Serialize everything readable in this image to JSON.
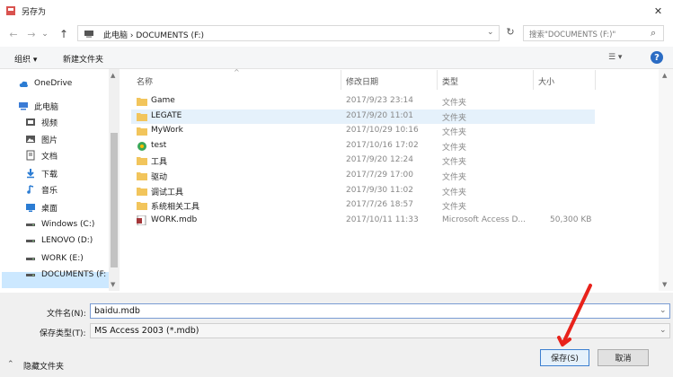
{
  "window": {
    "title": "另存为",
    "close_glyph": "✕"
  },
  "nav": {
    "back_glyph": "←",
    "forward_glyph": "→",
    "dropdown_glyph": "⌄",
    "up_glyph": "↑",
    "address": "此电脑  ›  DOCUMENTS (F:)",
    "search_placeholder": "搜索\"DOCUMENTS (F:)\"",
    "refresh_glyph": "↻",
    "search_glyph": "⌕"
  },
  "toolbar": {
    "organize": "组织 ▾",
    "new_folder": "新建文件夹",
    "view_glyph": "☰ ▾",
    "help_glyph": "?"
  },
  "sidebar": {
    "items": [
      {
        "label": "OneDrive",
        "icon": "cloud-icon",
        "color": "#2b7cd3"
      },
      {
        "label": "此电脑",
        "icon": "computer-icon",
        "color": "#3a7bd5"
      },
      {
        "label": "视频",
        "icon": "video-icon",
        "color": "#555555"
      },
      {
        "label": "图片",
        "icon": "picture-icon",
        "color": "#555555"
      },
      {
        "label": "文档",
        "icon": "document-icon",
        "color": "#555555"
      },
      {
        "label": "下载",
        "icon": "download-icon",
        "color": "#2b7cd3"
      },
      {
        "label": "音乐",
        "icon": "music-icon",
        "color": "#2b7cd3"
      },
      {
        "label": "桌面",
        "icon": "desktop-icon",
        "color": "#2b7cd3"
      },
      {
        "label": "Windows (C:)",
        "icon": "drive-icon",
        "color": "#555555"
      },
      {
        "label": "LENOVO (D:)",
        "icon": "drive-icon",
        "color": "#555555"
      },
      {
        "label": "WORK (E:)",
        "icon": "drive-icon",
        "color": "#555555"
      },
      {
        "label": "DOCUMENTS (F:",
        "icon": "drive-icon",
        "color": "#555555"
      }
    ]
  },
  "files": {
    "columns": {
      "name": "名称",
      "date": "修改日期",
      "type": "类型",
      "size": "大小"
    },
    "rows": [
      {
        "name": "Game",
        "date": "2017/9/23 23:14",
        "type": "文件夹",
        "size": "",
        "icon": "folder"
      },
      {
        "name": "LEGATE",
        "date": "2017/9/20 11:01",
        "type": "文件夹",
        "size": "",
        "icon": "folder"
      },
      {
        "name": "MyWork",
        "date": "2017/10/29 10:16",
        "type": "文件夹",
        "size": "",
        "icon": "folder"
      },
      {
        "name": "test",
        "date": "2017/10/16 17:02",
        "type": "文件夹",
        "size": "",
        "icon": "special"
      },
      {
        "name": "工具",
        "date": "2017/9/20 12:24",
        "type": "文件夹",
        "size": "",
        "icon": "folder"
      },
      {
        "name": "驱动",
        "date": "2017/7/29 17:00",
        "type": "文件夹",
        "size": "",
        "icon": "folder"
      },
      {
        "name": "调试工具",
        "date": "2017/9/30 11:02",
        "type": "文件夹",
        "size": "",
        "icon": "folder"
      },
      {
        "name": "系统相关工具",
        "date": "2017/7/26 18:57",
        "type": "文件夹",
        "size": "",
        "icon": "folder"
      },
      {
        "name": "WORK.mdb",
        "date": "2017/10/11 11:33",
        "type": "Microsoft Access D...",
        "size": "50,300 KB",
        "icon": "access"
      }
    ]
  },
  "form": {
    "filename_label": "文件名(N):",
    "filename_value": "baidu.mdb",
    "filetype_label": "保存类型(T):",
    "filetype_value": "MS Access 2003 (*.mdb)",
    "hide_folders": "隐藏文件夹",
    "hide_glyph": "⌃",
    "save": "保存(S)",
    "cancel": "取消"
  },
  "colors": {
    "folder": "#f2c55c",
    "accent": "#3c7fd0",
    "selection": "#e5f1fb",
    "annotation": "#e8221b"
  }
}
